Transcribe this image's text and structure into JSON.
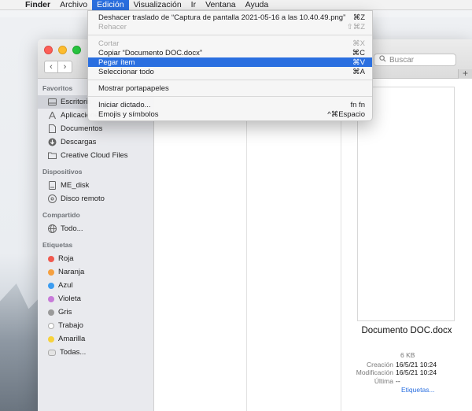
{
  "menubar": {
    "apple_icon": "apple-icon",
    "items": [
      "Finder",
      "Archivo",
      "Edición",
      "Visualización",
      "Ir",
      "Ventana",
      "Ayuda"
    ]
  },
  "edit_menu": {
    "items": [
      {
        "label": "Deshacer traslado de “Captura de pantalla 2021-05-16 a las 10.40.49.png”",
        "shortcut": "⌘Z"
      },
      {
        "label": "Rehacer",
        "shortcut": "⇧⌘Z"
      },
      {
        "label": "Cortar",
        "shortcut": "⌘X"
      },
      {
        "label": "Copiar “Documento DOC.docx”",
        "shortcut": "⌘C"
      },
      {
        "label": "Pegar ítem",
        "shortcut": "⌘V"
      },
      {
        "label": "Seleccionar todo",
        "shortcut": "⌘A"
      },
      {
        "label": "Mostrar portapapeles",
        "shortcut": ""
      },
      {
        "label": "Iniciar dictado...",
        "shortcut": "fn fn"
      },
      {
        "label": "Emojis y símbolos",
        "shortcut": "^⌘Espacio"
      }
    ]
  },
  "window": {
    "search_placeholder": "Buscar",
    "new_tab": "+"
  },
  "sidebar": {
    "favoritos": {
      "heading": "Favoritos",
      "items": [
        "Escritorio",
        "Aplicaciones",
        "Documentos",
        "Descargas",
        "Creative Cloud Files"
      ]
    },
    "dispositivos": {
      "heading": "Dispositivos",
      "items": [
        "ME_disk",
        "Disco remoto"
      ]
    },
    "compartido": {
      "heading": "Compartido",
      "items": [
        "Todo..."
      ]
    },
    "etiquetas": {
      "heading": "Etiquetas",
      "items": [
        {
          "label": "Roja",
          "color": "#f05a4f"
        },
        {
          "label": "Naranja",
          "color": "#f5a040"
        },
        {
          "label": "Azul",
          "color": "#3c9cf0"
        },
        {
          "label": "Violeta",
          "color": "#c77ad9"
        },
        {
          "label": "Gris",
          "color": "#9a9a9a"
        },
        {
          "label": "Trabajo",
          "color": "#ffffff"
        },
        {
          "label": "Amarilla",
          "color": "#f7d23c"
        },
        {
          "label": "Todas...",
          "color": "#ffffff"
        }
      ]
    }
  },
  "preview": {
    "name": "Documento DOC.docx",
    "size": "6 KB",
    "creacion_label": "Creación",
    "creacion": "16/5/21 10:24",
    "modificacion_label": "Modificación",
    "modificacion": "16/5/21 10:24",
    "ultima_label": "Última",
    "ultima": "--",
    "etiquetas_link": "Etiquetas..."
  },
  "colors": {
    "accent": "#2a6fe0"
  }
}
